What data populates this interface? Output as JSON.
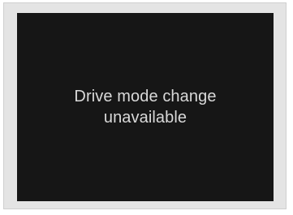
{
  "display": {
    "message_line1": "Drive mode change",
    "message_line2": "unavailable"
  },
  "colors": {
    "screen_background": "#161616",
    "message_text": "#d9d9d9",
    "frame": "#e4e4e4"
  }
}
